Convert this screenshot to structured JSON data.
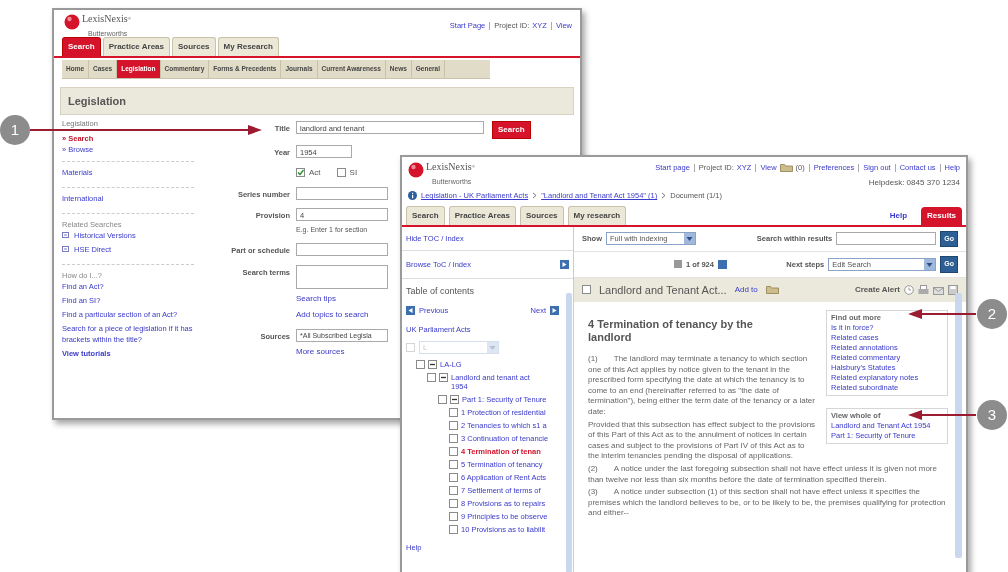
{
  "callouts": [
    {
      "number": "1"
    },
    {
      "number": "2"
    },
    {
      "number": "3"
    }
  ],
  "search_window": {
    "logo": {
      "name": "LexisNexis",
      "mark": "®",
      "tagline": "Butterworths"
    },
    "header_links": [
      {
        "kind": "link",
        "text": "Start Page"
      },
      {
        "kind": "label",
        "text": "Project ID:",
        "value": "XYZ"
      },
      {
        "kind": "link",
        "text": "View"
      }
    ],
    "tabs": [
      {
        "label": "Search",
        "selected": true
      },
      {
        "label": "Practice Areas",
        "selected": false
      },
      {
        "label": "Sources",
        "selected": false
      },
      {
        "label": "My Research",
        "selected": false
      }
    ],
    "subnav": [
      {
        "label": "Home",
        "selected": false
      },
      {
        "label": "Cases",
        "selected": false
      },
      {
        "label": "Legislation",
        "selected": true
      },
      {
        "label": "Commentary",
        "selected": false
      },
      {
        "label": "Forms & Precedents",
        "selected": false
      },
      {
        "label": "Journals",
        "selected": false
      },
      {
        "label": "Current Awareness",
        "selected": false
      },
      {
        "label": "News",
        "selected": false
      },
      {
        "label": "General",
        "selected": false
      }
    ],
    "page_title": "Legislation",
    "sidebar": [
      {
        "items": [
          {
            "kind": "heading",
            "text": "Legislation"
          },
          {
            "kind": "nav",
            "text": "» Search",
            "selected": true
          },
          {
            "kind": "nav",
            "text": "» Browse",
            "selected": false
          }
        ]
      },
      {
        "items": [
          {
            "kind": "link",
            "text": "Materials"
          }
        ]
      },
      {
        "items": [
          {
            "kind": "link",
            "text": "International"
          }
        ]
      },
      {
        "items": [
          {
            "kind": "caption",
            "text": "Related Searches"
          },
          {
            "kind": "icon_link",
            "text": "Historical Versions"
          },
          {
            "kind": "icon_link",
            "text": "HSE Direct"
          }
        ]
      },
      {
        "items": [
          {
            "kind": "caption",
            "text": "How do I...?"
          },
          {
            "kind": "link",
            "text": "Find an Act?"
          },
          {
            "kind": "link",
            "text": "Find an SI?"
          },
          {
            "kind": "link",
            "text": "Find a particular section of an Act?"
          },
          {
            "kind": "link",
            "text": "Search for a piece of legislation if it has brackets within the title?"
          },
          {
            "kind": "strong_link",
            "text": "View tutorials"
          }
        ]
      }
    ],
    "form": [
      {
        "kind": "text",
        "label": "Title",
        "value": "landlord and tenant",
        "button": "Search"
      },
      {
        "kind": "short",
        "label": "Year",
        "value": "1954"
      },
      {
        "kind": "checks",
        "options": [
          {
            "label": "Act",
            "checked": true
          },
          {
            "label": "SI",
            "checked": false
          }
        ]
      },
      {
        "kind": "text",
        "label": "Series number"
      },
      {
        "kind": "text",
        "label": "Provision",
        "value": "4",
        "hint": "E.g. Enter 1 for section"
      },
      {
        "kind": "text",
        "label": "Part or schedule"
      },
      {
        "kind": "area",
        "label": "Search terms",
        "links": [
          "Search tips",
          "Add topics to search"
        ]
      },
      {
        "kind": "select",
        "label": "Sources",
        "value": "*All Subscribed Legisla",
        "links": [
          "More sources"
        ]
      }
    ]
  },
  "results_window": {
    "logo": {
      "name": "LexisNexis",
      "mark": "®",
      "tagline": "Butterworths"
    },
    "header_links": [
      {
        "kind": "link",
        "text": "Start page"
      },
      {
        "kind": "label",
        "text": "Project ID:",
        "value": "XYZ"
      },
      {
        "kind": "folder",
        "text": "View",
        "count": "(0)"
      },
      {
        "kind": "link",
        "text": "Preferences"
      },
      {
        "kind": "link",
        "text": "Sign out"
      },
      {
        "kind": "link",
        "text": "Contact us"
      },
      {
        "kind": "link",
        "text": "Help"
      }
    ],
    "helpdesk": "Helpdesk: 0845 370 1234",
    "breadcrumb": [
      {
        "kind": "link",
        "text": "Legislation - UK Parliament Acts"
      },
      {
        "kind": "link",
        "text": "\"Landlord and Tenant Act 1954\" (1)"
      },
      {
        "kind": "text",
        "text": "Document (1/1)"
      }
    ],
    "tabs": [
      {
        "label": "Search",
        "selected": false
      },
      {
        "label": "Practice Areas",
        "selected": false
      },
      {
        "label": "Sources",
        "selected": false
      },
      {
        "label": "My research",
        "selected": false
      }
    ],
    "right_tabs": [
      {
        "label": "Help",
        "selected": false
      },
      {
        "label": "Results",
        "selected": true
      }
    ],
    "toc": {
      "hide_link": "Hide TOC / Index",
      "browse_link": "Browse ToC / Index",
      "title": "Table of contents",
      "previous": "Previous",
      "next": "Next",
      "source": "UK Parliament Acts",
      "filter": {
        "value": "L",
        "disabled": true,
        "checked": false
      },
      "tree": [
        {
          "label": "LA-LG",
          "checked": false,
          "expanded": true,
          "children": [
            {
              "label": "Landlord and tenant act 1954",
              "checked": false,
              "expanded": true,
              "children": [
                {
                  "label": "Part 1: Security of Tenure",
                  "checked": false,
                  "expanded": true,
                  "children": [
                    {
                      "label": "1 Protection of residential",
                      "checked": false,
                      "selected": false
                    },
                    {
                      "label": "2 Tenancies to which s1 a",
                      "checked": false,
                      "selected": false
                    },
                    {
                      "label": "3 Continuation of tenancie",
                      "checked": false,
                      "selected": false
                    },
                    {
                      "label": "4 Termination of tenan",
                      "checked": false,
                      "selected": true
                    },
                    {
                      "label": "5 Termination of tenancy",
                      "checked": false,
                      "selected": false
                    },
                    {
                      "label": "6 Application of Rent Acts",
                      "checked": false,
                      "selected": false
                    },
                    {
                      "label": "7 Settlement of terms of",
                      "checked": false,
                      "selected": false
                    },
                    {
                      "label": "8 Provisions as to repairs",
                      "checked": false,
                      "selected": false
                    },
                    {
                      "label": "9 Principles to be observe",
                      "checked": false,
                      "selected": false
                    },
                    {
                      "label": "10 Provisions as to liabilit",
                      "checked": false,
                      "selected": false
                    }
                  ]
                }
              ]
            }
          ]
        }
      ],
      "help": "Help"
    },
    "toolbar": {
      "show_label": "Show",
      "show_value": "Full with indexing",
      "search_label": "Search within results",
      "go": "Go",
      "pager": "1 of 924",
      "next_steps_label": "Next steps",
      "next_steps_value": "Edit Search",
      "go_next": "Go"
    },
    "document": {
      "title": "Landlord and Tenant Act...",
      "checked": false,
      "add_to": "Add to",
      "create_alert": "Create Alert",
      "heading": "4 Termination of tenancy by the landlord",
      "find_out_more": {
        "title": "Find out more",
        "links": [
          "Is it in force?",
          "Related cases",
          "Related annotations",
          "Related commentary",
          "Halsbury's Statutes",
          "Related explanatory notes",
          "Related subordinate"
        ]
      },
      "view_whole": {
        "title": "View whole of",
        "links": [
          "Landlord and Tenant Act 1954",
          "Part 1: Security of Tenure"
        ]
      },
      "paragraphs": [
        {
          "number": "(1)",
          "text": "The landlord may terminate a tenancy to which section one of this Act applies by notice given to the tenant in the prescribed form specifying the date at which the tenancy is to come to an end (hereinafter referred to as \"the date of termination\"), being either the term date of the tenancy or a later date:"
        },
        {
          "text": "Provided that this subsection has effect subject to the provisions of this Part of this Act as to the annulment of notices in certain cases and subject to the provisions of Part IV of this Act as to the interim tenancies pending the disposal of applications."
        },
        {
          "number": "(2)",
          "text": "A notice under the last foregoing subsection shall not have effect unless it is given not more than twelve nor less than six months before the date of termination specified therein."
        },
        {
          "number": "(3)",
          "text": "A notice under subsection (1) of this section shall not have effect unless it specifies the premises which the landlord believes to be, or to be likely to be, the premises qualifying for protection and either--"
        }
      ]
    }
  }
}
